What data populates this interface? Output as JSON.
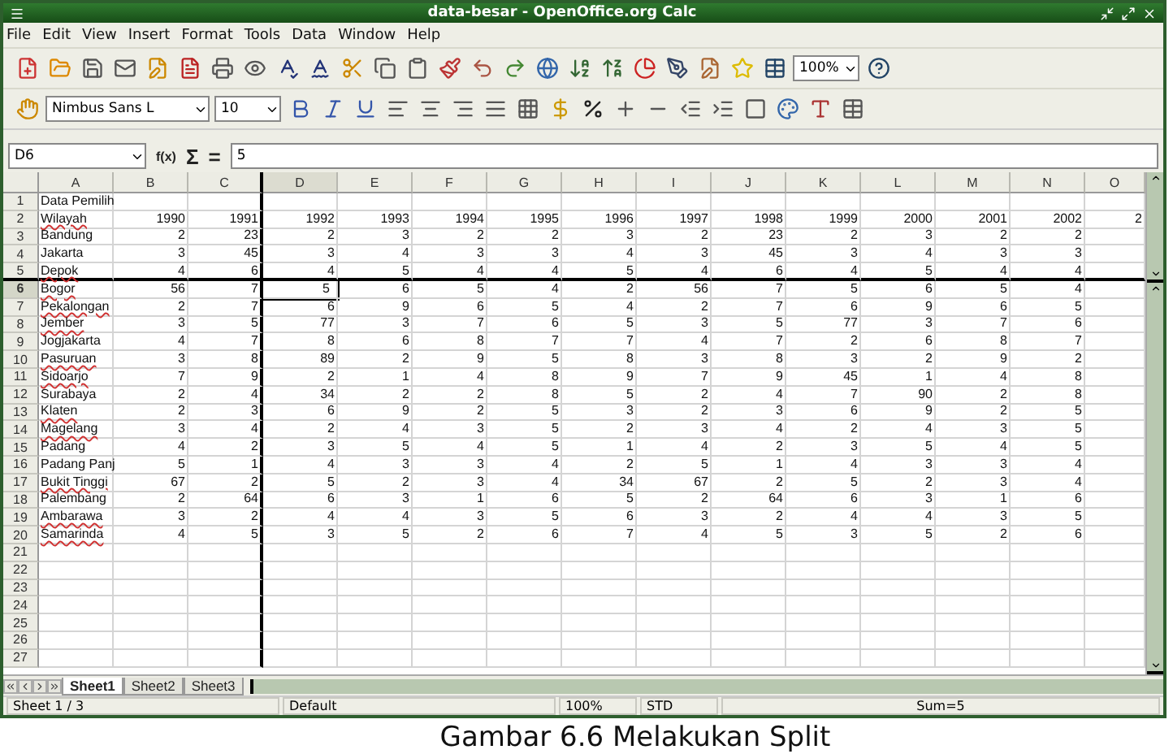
{
  "window": {
    "title": "data-besar - OpenOffice.org Calc"
  },
  "menu": [
    "File",
    "Edit",
    "View",
    "Insert",
    "Format",
    "Tools",
    "Data",
    "Window",
    "Help"
  ],
  "toolbar": {
    "zoom": "100%"
  },
  "format_bar": {
    "font_name": "Nimbus Sans L",
    "font_size": "10"
  },
  "formula_bar": {
    "name_box": "D6",
    "buttons": [
      "f(x)",
      "Σ",
      "="
    ],
    "value": "5"
  },
  "columns": [
    {
      "label": "A",
      "selected": false
    },
    {
      "label": "B",
      "selected": false
    },
    {
      "label": "C",
      "selected": false
    },
    {
      "label": "D",
      "selected": true
    },
    {
      "label": "E",
      "selected": false
    },
    {
      "label": "F",
      "selected": false
    },
    {
      "label": "G",
      "selected": false
    },
    {
      "label": "H",
      "selected": false
    },
    {
      "label": "I",
      "selected": false
    },
    {
      "label": "J",
      "selected": false
    },
    {
      "label": "K",
      "selected": false
    },
    {
      "label": "L",
      "selected": false
    },
    {
      "label": "M",
      "selected": false
    },
    {
      "label": "N",
      "selected": false
    },
    {
      "label": "O",
      "selected": false
    }
  ],
  "rows": [
    {
      "number": "1",
      "label": "Data Pemilih",
      "misspelled": false,
      "selected": false,
      "values": []
    },
    {
      "number": "2",
      "label": "Wilayah",
      "misspelled": true,
      "selected": false,
      "values": [
        "1990",
        "1991",
        "1992",
        "1993",
        "1994",
        "1995",
        "1996",
        "1997",
        "1998",
        "1999",
        "2000",
        "2001",
        "2002",
        "2"
      ]
    },
    {
      "number": "3",
      "label": "Bandung",
      "misspelled": false,
      "selected": false,
      "values": [
        "2",
        "23",
        "2",
        "3",
        "2",
        "2",
        "3",
        "2",
        "23",
        "2",
        "3",
        "2",
        "2"
      ]
    },
    {
      "number": "4",
      "label": "Jakarta",
      "misspelled": false,
      "selected": false,
      "values": [
        "3",
        "45",
        "3",
        "4",
        "3",
        "3",
        "4",
        "3",
        "45",
        "3",
        "4",
        "3",
        "3"
      ]
    },
    {
      "number": "5",
      "label": "Depok",
      "misspelled": true,
      "selected": false,
      "values": [
        "4",
        "6",
        "4",
        "5",
        "4",
        "4",
        "5",
        "4",
        "6",
        "4",
        "5",
        "4",
        "4"
      ]
    },
    {
      "number": "6",
      "label": "Bogor",
      "misspelled": true,
      "selected": true,
      "values": [
        "56",
        "7",
        "5",
        "6",
        "5",
        "4",
        "2",
        "56",
        "7",
        "5",
        "6",
        "5",
        "4"
      ]
    },
    {
      "number": "7",
      "label": "Pekalongan",
      "misspelled": true,
      "selected": false,
      "values": [
        "2",
        "7",
        "6",
        "9",
        "6",
        "5",
        "4",
        "2",
        "7",
        "6",
        "9",
        "6",
        "5"
      ]
    },
    {
      "number": "8",
      "label": "Jember",
      "misspelled": true,
      "selected": false,
      "values": [
        "3",
        "5",
        "77",
        "3",
        "7",
        "6",
        "5",
        "3",
        "5",
        "77",
        "3",
        "7",
        "6"
      ]
    },
    {
      "number": "9",
      "label": "Jogjakarta",
      "misspelled": false,
      "selected": false,
      "values": [
        "4",
        "7",
        "8",
        "6",
        "8",
        "7",
        "7",
        "4",
        "7",
        "2",
        "6",
        "8",
        "7"
      ]
    },
    {
      "number": "10",
      "label": "Pasuruan",
      "misspelled": true,
      "selected": false,
      "values": [
        "3",
        "8",
        "89",
        "2",
        "9",
        "5",
        "8",
        "3",
        "8",
        "3",
        "2",
        "9",
        "2"
      ]
    },
    {
      "number": "11",
      "label": "Sidoarjo",
      "misspelled": true,
      "selected": false,
      "values": [
        "7",
        "9",
        "2",
        "1",
        "4",
        "8",
        "9",
        "7",
        "9",
        "45",
        "1",
        "4",
        "8"
      ]
    },
    {
      "number": "12",
      "label": "Surabaya",
      "misspelled": false,
      "selected": false,
      "values": [
        "2",
        "4",
        "34",
        "2",
        "2",
        "8",
        "5",
        "2",
        "4",
        "7",
        "90",
        "2",
        "8"
      ]
    },
    {
      "number": "13",
      "label": "Klaten",
      "misspelled": true,
      "selected": false,
      "values": [
        "2",
        "3",
        "6",
        "9",
        "2",
        "5",
        "3",
        "2",
        "3",
        "6",
        "9",
        "2",
        "5"
      ]
    },
    {
      "number": "14",
      "label": "Magelang",
      "misspelled": true,
      "selected": false,
      "values": [
        "3",
        "4",
        "2",
        "4",
        "3",
        "5",
        "2",
        "3",
        "4",
        "2",
        "4",
        "3",
        "5"
      ]
    },
    {
      "number": "15",
      "label": "Padang",
      "misspelled": false,
      "selected": false,
      "values": [
        "4",
        "2",
        "3",
        "5",
        "4",
        "5",
        "1",
        "4",
        "2",
        "3",
        "5",
        "4",
        "5"
      ]
    },
    {
      "number": "16",
      "label": "Padang Panj",
      "misspelled": false,
      "selected": false,
      "values": [
        "5",
        "1",
        "4",
        "3",
        "3",
        "4",
        "2",
        "5",
        "1",
        "4",
        "3",
        "3",
        "4"
      ]
    },
    {
      "number": "17",
      "label": "Bukit Tinggi",
      "misspelled": true,
      "selected": false,
      "values": [
        "67",
        "2",
        "5",
        "2",
        "3",
        "4",
        "34",
        "67",
        "2",
        "5",
        "2",
        "3",
        "4"
      ]
    },
    {
      "number": "18",
      "label": "Palembang",
      "misspelled": false,
      "selected": false,
      "values": [
        "2",
        "64",
        "6",
        "3",
        "1",
        "6",
        "5",
        "2",
        "64",
        "6",
        "3",
        "1",
        "6"
      ]
    },
    {
      "number": "19",
      "label": "Ambarawa",
      "misspelled": true,
      "selected": false,
      "values": [
        "3",
        "2",
        "4",
        "4",
        "3",
        "5",
        "6",
        "3",
        "2",
        "4",
        "4",
        "3",
        "5"
      ]
    },
    {
      "number": "20",
      "label": "Samarinda",
      "misspelled": true,
      "selected": false,
      "values": [
        "4",
        "5",
        "3",
        "5",
        "2",
        "6",
        "7",
        "4",
        "5",
        "3",
        "5",
        "2",
        "6"
      ]
    },
    {
      "number": "21",
      "selected": false,
      "values": []
    },
    {
      "number": "22",
      "selected": false,
      "values": []
    },
    {
      "number": "23",
      "selected": false,
      "values": []
    },
    {
      "number": "24",
      "selected": false,
      "values": []
    },
    {
      "number": "25",
      "selected": false,
      "values": []
    },
    {
      "number": "26",
      "selected": false,
      "values": []
    },
    {
      "number": "27",
      "selected": false,
      "values": []
    }
  ],
  "sheets": [
    {
      "label": "Sheet1",
      "selected": true
    },
    {
      "label": "Sheet2",
      "selected": false
    },
    {
      "label": "Sheet3",
      "selected": false
    }
  ],
  "status_bar": {
    "sheet": "Sheet 1 / 3",
    "style": "Default",
    "zoom": "100%",
    "mode": "STD",
    "sum": "Sum=5"
  },
  "caption": "Gambar 6.6 Melakukan Split"
}
